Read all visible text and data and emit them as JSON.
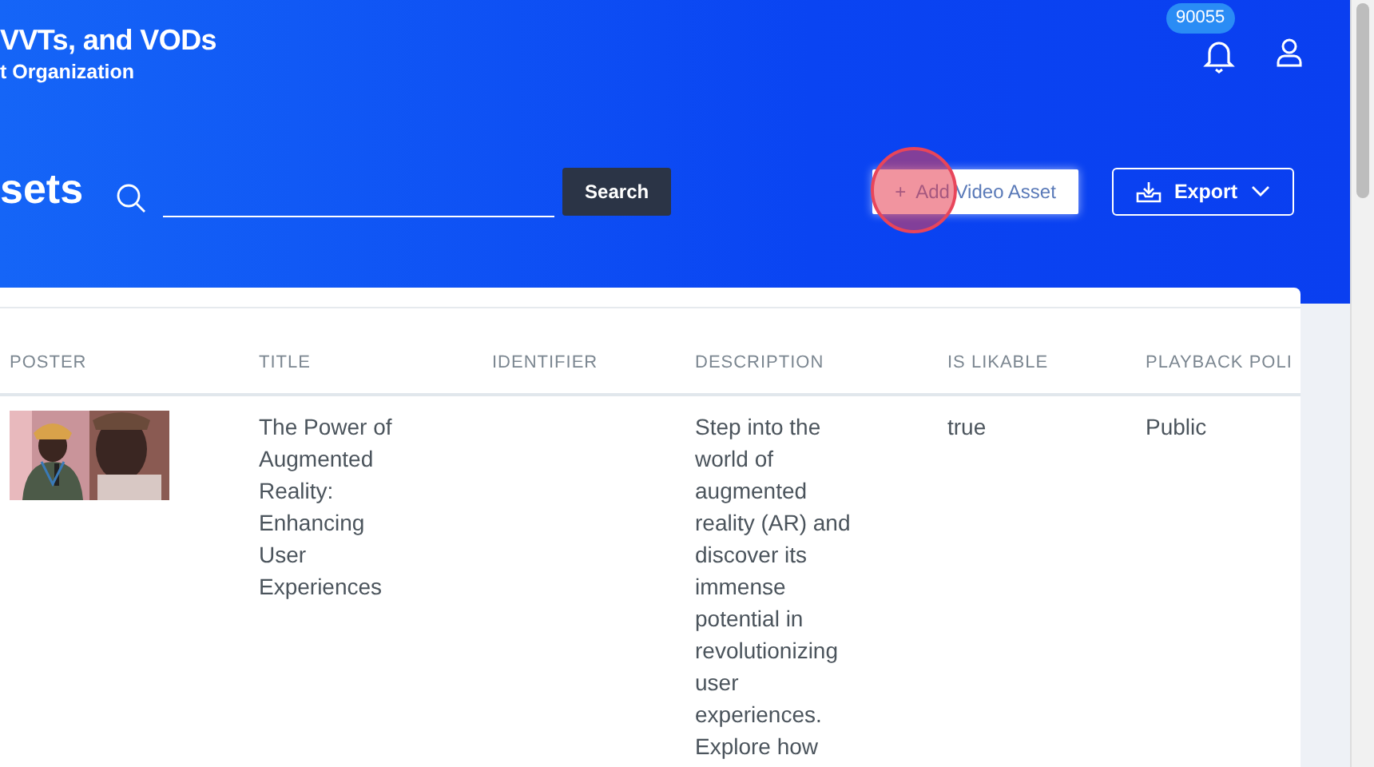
{
  "header": {
    "title": "VVTs, and VODs",
    "subtitle": "t Organization",
    "notification_count": "90055"
  },
  "toolbar": {
    "heading": "sets",
    "search_button": "Search",
    "add_button": {
      "icon": "+",
      "label": "Add Video Asset"
    },
    "export_button": "Export"
  },
  "table": {
    "columns": [
      "POSTER",
      "TITLE",
      "IDENTIFIER",
      "DESCRIPTION",
      "IS LIKABLE",
      "PLAYBACK POLI"
    ],
    "rows": [
      {
        "title": "The Power of Augmented Reality: Enhancing User Experiences",
        "identifier": "",
        "description": "Step into the world of augmented reality (AR) and discover its immense potential in revolutionizing user experiences. Explore how",
        "is_likable": "true",
        "playback_policy": "Public"
      }
    ]
  }
}
